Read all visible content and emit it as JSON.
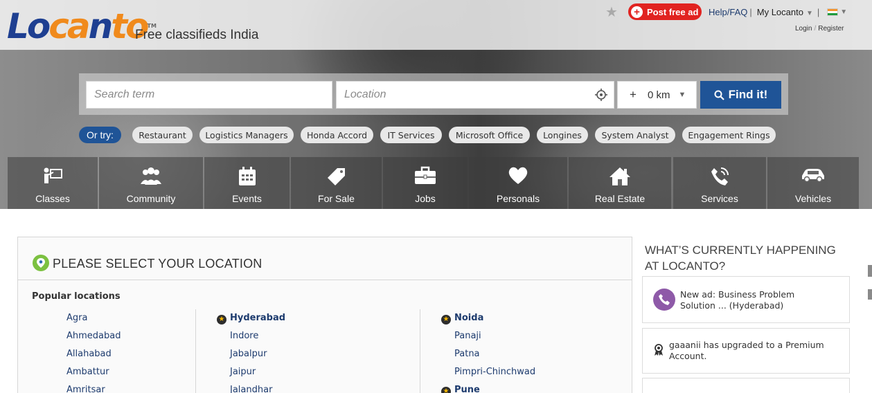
{
  "brand": {
    "logo_blue": "Lo",
    "logo_orange1": "ca",
    "logo_blue2": "n",
    "logo_orange2": "to",
    "trademark": "TM",
    "tagline": "Free classifieds India"
  },
  "header": {
    "post_ad": "Post free ad",
    "help": "Help/FAQ",
    "sep": "|",
    "my_locanto": "My Locanto",
    "sep2": "|",
    "login": "Login",
    "register": "Register",
    "login_sep": "/"
  },
  "search": {
    "term_placeholder": "Search term",
    "location_placeholder": "Location",
    "radius_plus": "+",
    "radius_value": "0 km",
    "find_label": "Find it!"
  },
  "or_try": {
    "label": "Or try:",
    "chips": [
      "Restaurant",
      "Logistics Managers",
      "Honda Accord",
      "IT Services",
      "Microsoft Office",
      "Longines",
      "System Analyst",
      "Engagement Rings"
    ]
  },
  "categories": [
    {
      "label": "Classes",
      "icon": "teacher-icon"
    },
    {
      "label": "Community",
      "icon": "people-icon"
    },
    {
      "label": "Events",
      "icon": "calendar-icon"
    },
    {
      "label": "For Sale",
      "icon": "tag-icon"
    },
    {
      "label": "Jobs",
      "icon": "briefcase-icon"
    },
    {
      "label": "Personals",
      "icon": "heart-icon"
    },
    {
      "label": "Real Estate",
      "icon": "house-icon"
    },
    {
      "label": "Services",
      "icon": "phone-icon"
    },
    {
      "label": "Vehicles",
      "icon": "car-icon"
    }
  ],
  "location_panel": {
    "title": "PLEASE SELECT YOUR LOCATION",
    "popular_title": "Popular locations",
    "col1": [
      "Agra",
      "Ahmedabad",
      "Allahabad",
      "Ambattur",
      "Amritsar"
    ],
    "col2": [
      "Hyderabad",
      "Indore",
      "Jabalpur",
      "Jaipur",
      "Jalandhar"
    ],
    "col3": [
      "Noida",
      "Panaji",
      "Patna",
      "Pimpri-Chinchwad",
      "Pune"
    ]
  },
  "happening": {
    "title_line1": "WHAT’S CURRENTLY HAPPENING",
    "title_line2": "AT LOCANTO?",
    "items": [
      {
        "line1": "New ad: Business Problem",
        "line2": "Solution ... (Hyderabad)"
      },
      {
        "line1": "gaaanii has upgraded to a Premium",
        "line2": "Account."
      }
    ]
  },
  "colors": {
    "brand_blue": "#1f5497",
    "brand_orange": "#f08a1c",
    "post_red": "#e12320",
    "link_blue": "#1d3b6e"
  }
}
